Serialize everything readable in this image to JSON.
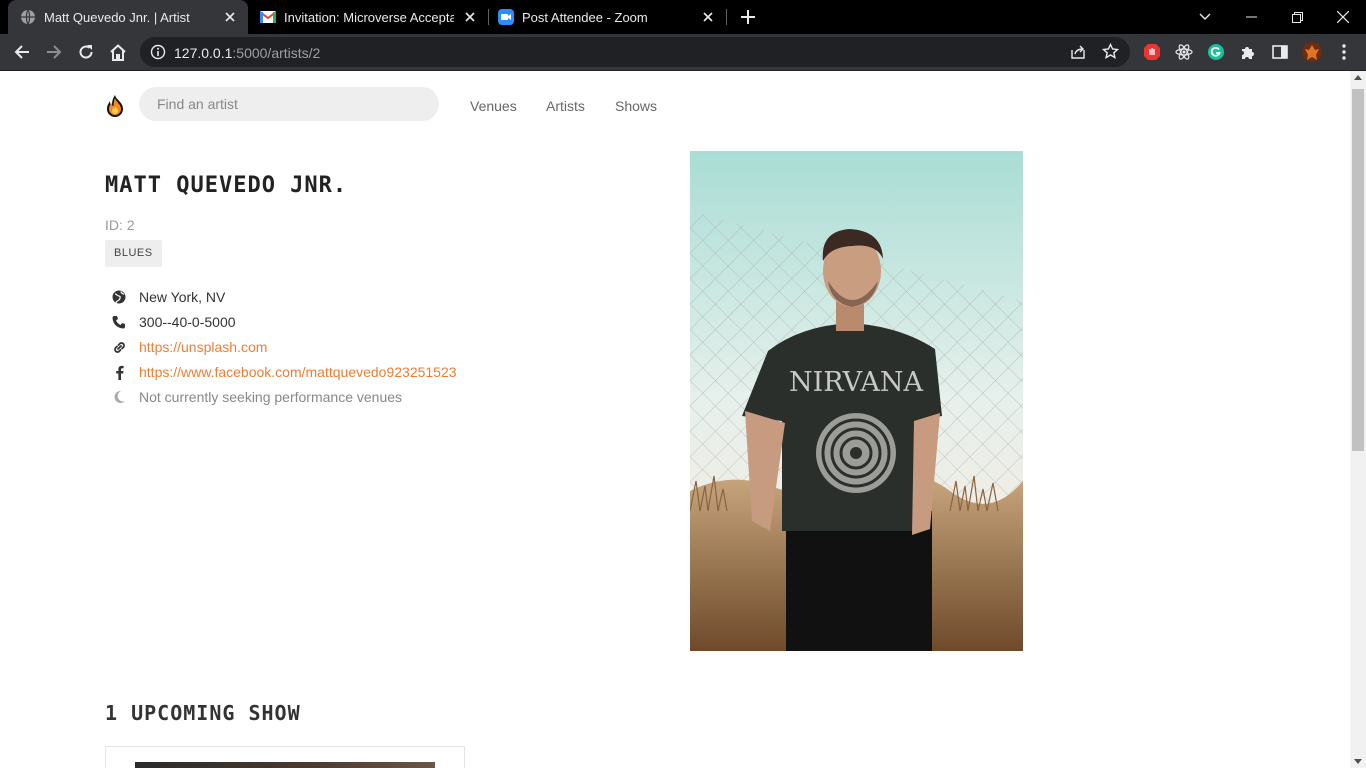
{
  "browser": {
    "tabs": [
      {
        "title": "Matt Quevedo Jnr. | Artist",
        "icon": "globe-icon",
        "active": true
      },
      {
        "title": "Invitation: Microverse Acceptance",
        "icon": "gmail-icon",
        "active": false
      },
      {
        "title": "Post Attendee - Zoom",
        "icon": "zoom-icon",
        "active": false
      }
    ],
    "url_host": "127.0.0.1",
    "url_path": ":5000/artists/2"
  },
  "site": {
    "search_placeholder": "Find an artist",
    "nav": [
      "Venues",
      "Artists",
      "Shows"
    ]
  },
  "artist": {
    "name": "MATT QUEVEDO JNR.",
    "id_label": "ID: 2",
    "genre": "BLUES",
    "city": "New York, NV",
    "phone": "300--40-0-5000",
    "website": "https://unsplash.com",
    "facebook": "https://www.facebook.com/mattquevedo923251523",
    "seeking": "Not currently seeking performance venues",
    "photo_shirt_text": "NIRVANA"
  },
  "shows": {
    "upcoming_heading": "1 UPCOMING SHOW"
  },
  "colors": {
    "accent": "#ef7d35",
    "chrome_dark": "#35363a",
    "tabbar": "#000000"
  }
}
